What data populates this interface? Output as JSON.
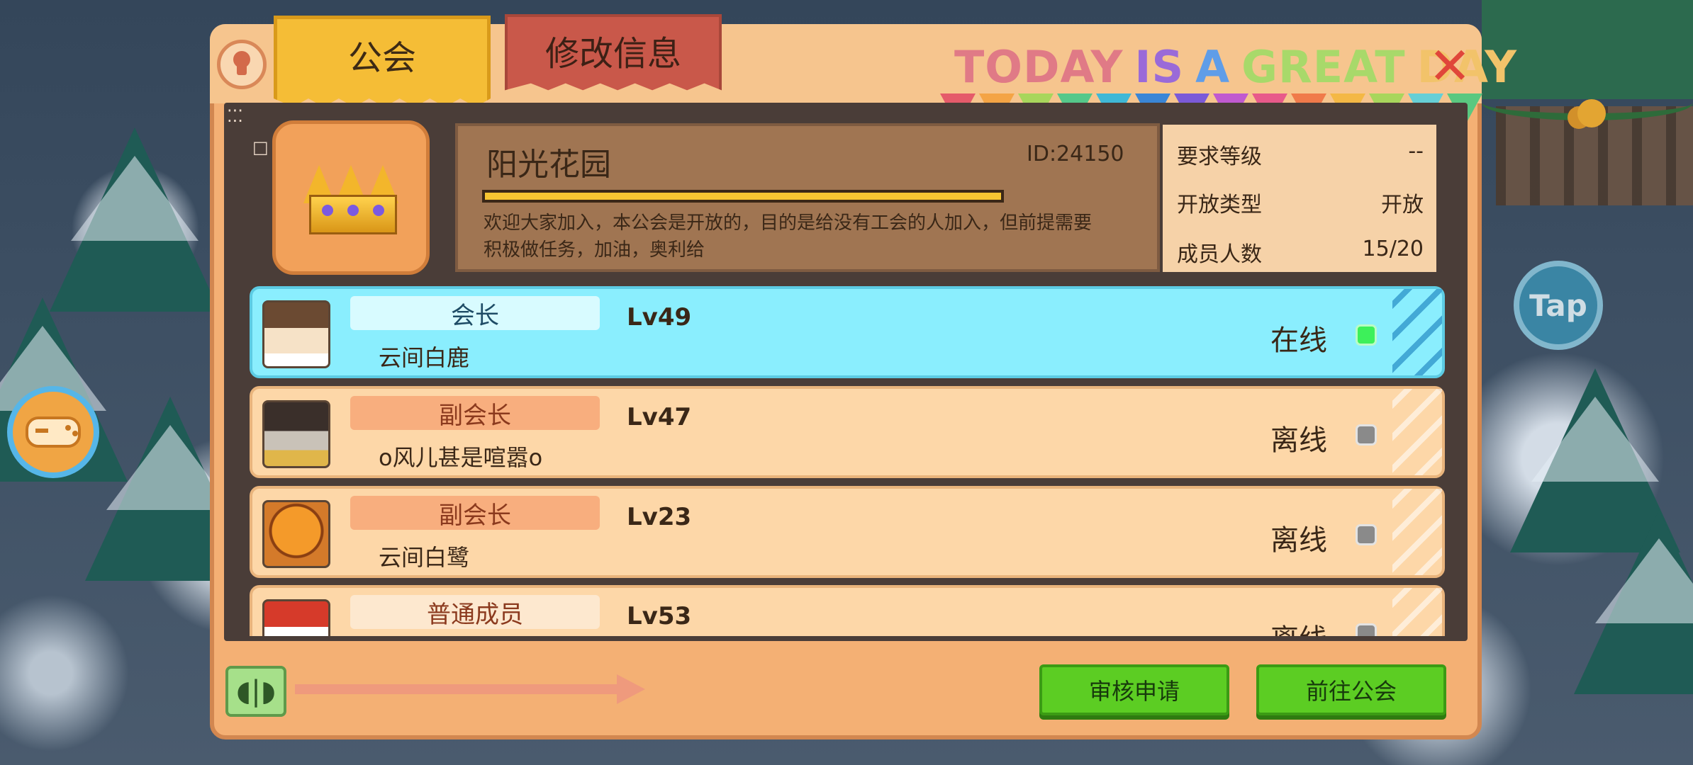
{
  "tabs": {
    "guild": "公会",
    "edit_info": "修改信息"
  },
  "slogan": {
    "words": [
      {
        "text": "TODAY",
        "color": "#e07a86"
      },
      {
        "text": "IS",
        "color": "#9a6ad8"
      },
      {
        "text": "A",
        "color": "#5f9de8"
      },
      {
        "text": "GREAT",
        "color": "#a8d96a"
      },
      {
        "text": "DAY",
        "color": "#f2c36a"
      }
    ]
  },
  "bunting_colors": [
    "#e55b6a",
    "#f4a445",
    "#a8d65c",
    "#55c88a",
    "#3fb8d6",
    "#3a86d6",
    "#7b5ad8",
    "#c05ad0",
    "#e85a8a",
    "#f07a4a",
    "#f4b845",
    "#a8d65c",
    "#66cfd6",
    "#5ac880"
  ],
  "guild": {
    "name": "阳光花园",
    "id_text": "ID:24150",
    "description": "欢迎大家加入，本公会是开放的，目的是给没有工会的人加入，但前提需要积极做任务，加油，奥利给"
  },
  "stats": [
    {
      "label": "要求等级",
      "value": "--"
    },
    {
      "label": "开放类型",
      "value": "开放"
    },
    {
      "label": "成员人数",
      "value": "15/20"
    }
  ],
  "members": [
    {
      "role": "会长",
      "name": "云间白鹿",
      "level": "Lv49",
      "status": "在线",
      "online": true
    },
    {
      "role": "副会长",
      "name": "o风儿甚是喧嚣o",
      "level": "Lv47",
      "status": "离线",
      "online": false
    },
    {
      "role": "副会长",
      "name": "云间白鹭",
      "level": "Lv23",
      "status": "离线",
      "online": false
    },
    {
      "role": "普通成员",
      "name": "",
      "level": "Lv53",
      "status": "离线",
      "online": false
    }
  ],
  "buttons": {
    "review": "审核申请",
    "goto_guild": "前往公会"
  },
  "tap_label": "Tap",
  "colors": {
    "online_row": "#8aeefe",
    "offline_row": "#fdd7a8",
    "role_offline_bg": "#f8ae7e",
    "button_green": "#5ccd23"
  }
}
